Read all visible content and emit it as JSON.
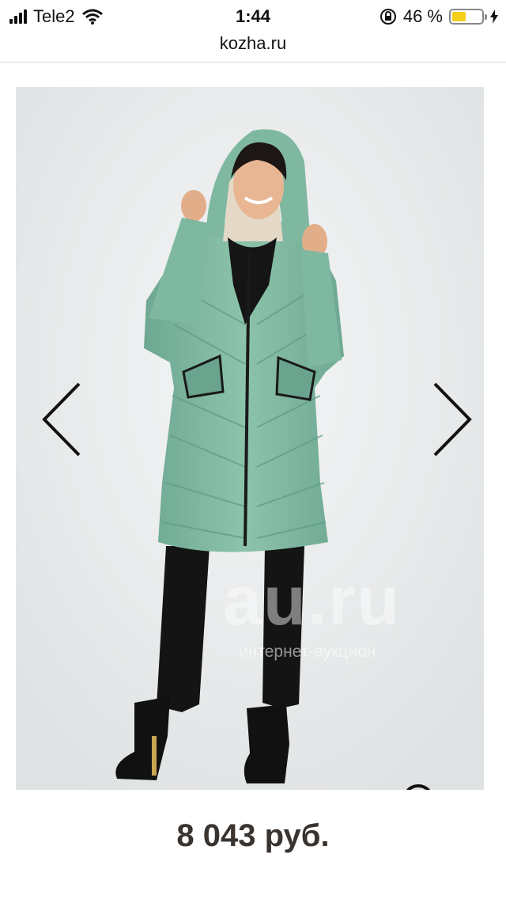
{
  "status_bar": {
    "carrier": "Tele2",
    "time": "1:44",
    "battery_percent": "46 %",
    "battery_level": 0.46,
    "battery_color": "#f5cd1b"
  },
  "browser": {
    "url": "kozha.ru"
  },
  "product": {
    "image_watermark": "au.ru",
    "image_watermark_sub": "интернет-аукцион",
    "price": "8 043 руб."
  },
  "icons": {
    "prev": "chevron-left-icon",
    "next": "chevron-right-icon",
    "zoom": "magnifier-icon"
  },
  "colors": {
    "coat": "#7fb8a0",
    "background": "#e9ebec",
    "price_text": "#3a3430"
  }
}
